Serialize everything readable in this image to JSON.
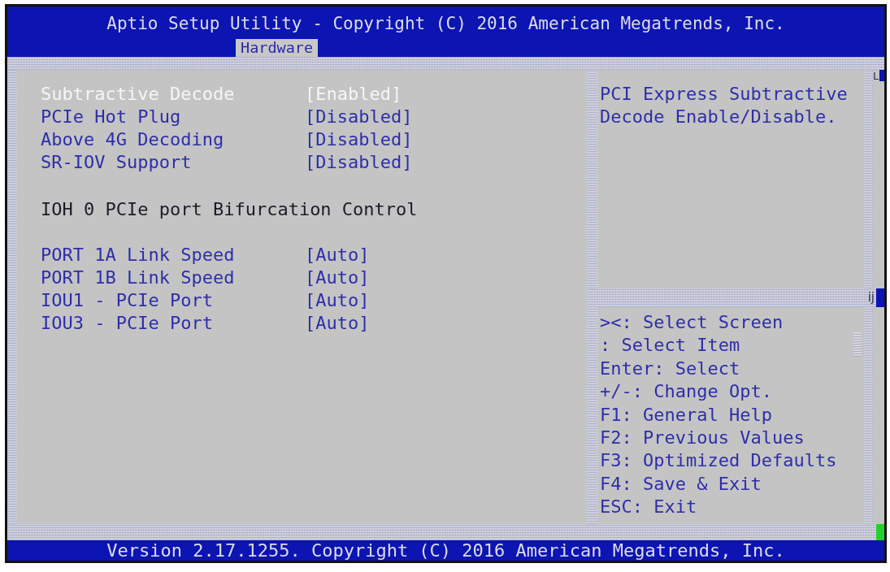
{
  "header": {
    "title": "Aptio Setup Utility - Copyright (C) 2016 American Megatrends, Inc.",
    "tabs": [
      {
        "label": "Hardware",
        "selected": true
      }
    ]
  },
  "settings": [
    {
      "kind": "option",
      "label": "Subtractive Decode",
      "value": "[Enabled]",
      "selected": true
    },
    {
      "kind": "option",
      "label": "PCIe Hot Plug",
      "value": "[Disabled]",
      "selected": false
    },
    {
      "kind": "option",
      "label": "Above 4G Decoding",
      "value": "[Disabled]",
      "selected": false
    },
    {
      "kind": "option",
      "label": "SR-IOV Support",
      "value": "[Disabled]",
      "selected": false
    },
    {
      "kind": "heading",
      "label": "IOH 0 PCIe port Bifurcation Control"
    },
    {
      "kind": "option",
      "label": "PORT 1A Link Speed",
      "value": "[Auto]",
      "selected": false
    },
    {
      "kind": "option",
      "label": "PORT 1B Link Speed",
      "value": "[Auto]",
      "selected": false
    },
    {
      "kind": "option",
      "label": "IOU1 - PCIe Port",
      "value": "[Auto]",
      "selected": false
    },
    {
      "kind": "option",
      "label": "IOU3 - PCIe Port",
      "value": "[Auto]",
      "selected": false
    }
  ],
  "help_panel": {
    "text": "PCI Express Subtractive Decode Enable/Disable.",
    "corner_glyph": "L",
    "divider_glyph": "ij"
  },
  "key_hints": [
    "><: Select Screen",
    ": Select Item",
    "Enter: Select",
    "+/-: Change Opt.",
    "F1: General Help",
    "F2: Previous Values",
    "F3: Optimized Defaults",
    "F4: Save & Exit",
    "ESC: Exit"
  ],
  "footer": {
    "text": "Version 2.17.1255. Copyright (C) 2016 American Megatrends, Inc."
  }
}
